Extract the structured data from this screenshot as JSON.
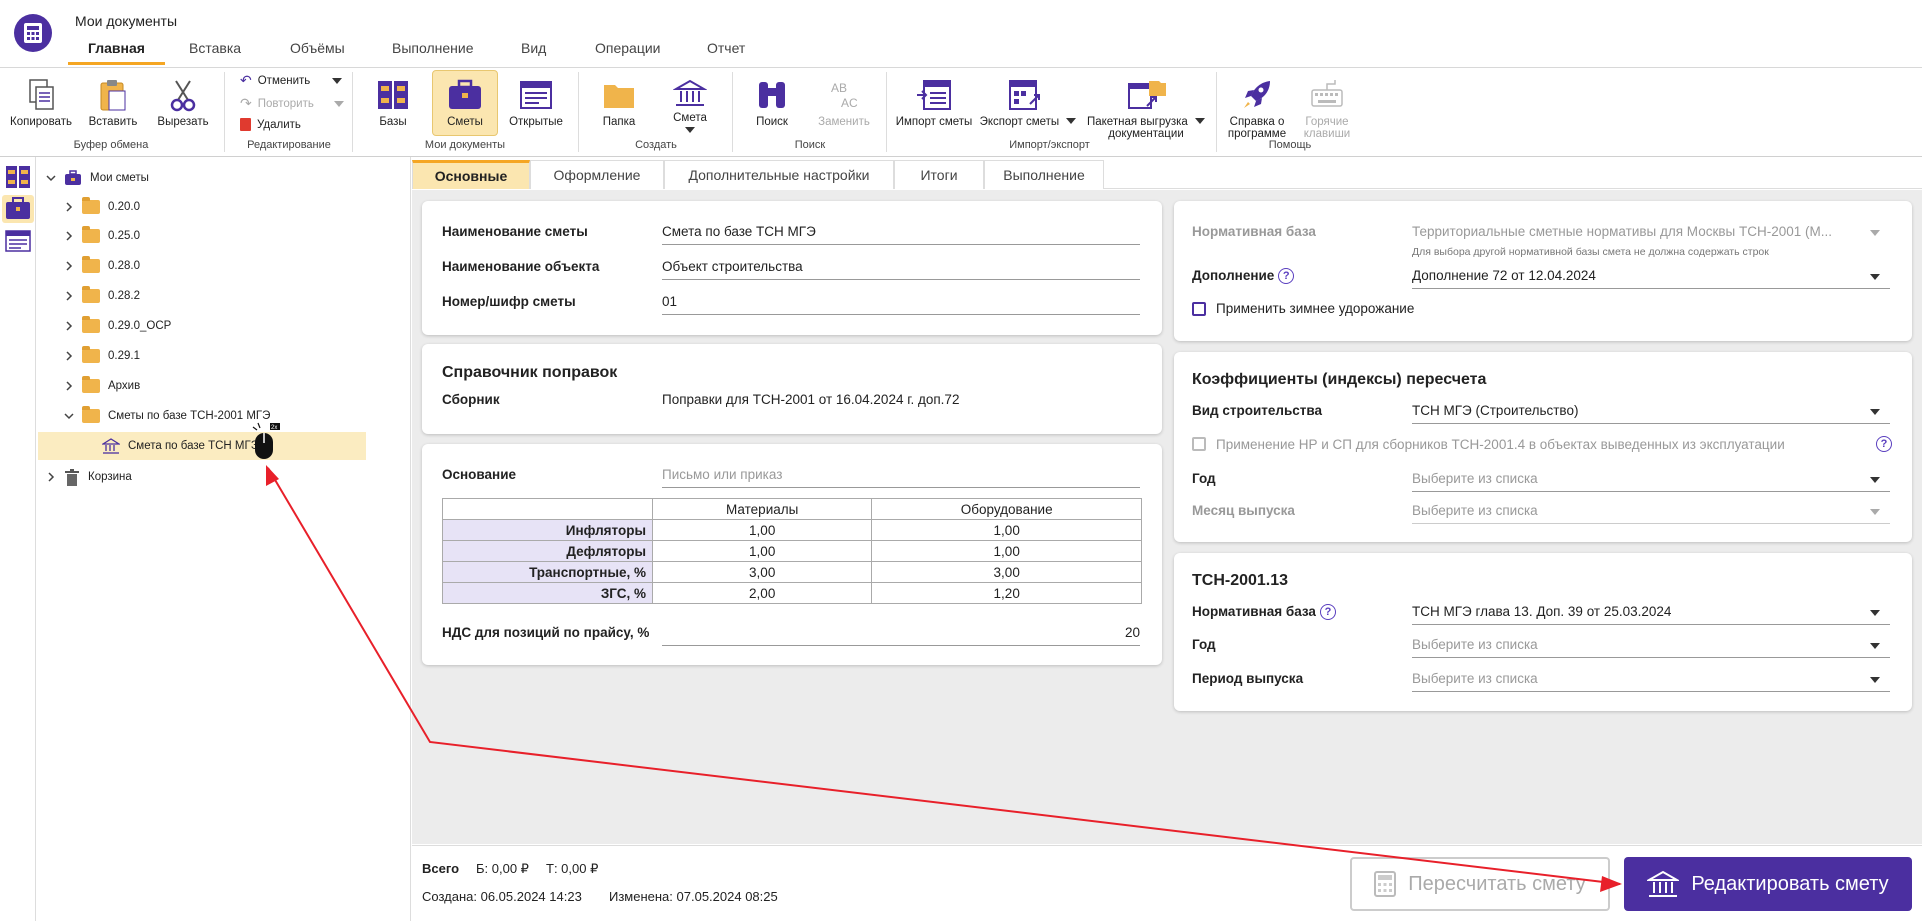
{
  "window": {
    "title": "Мои документы"
  },
  "ribbon_tabs": [
    "Главная",
    "Вставка",
    "Объёмы",
    "Выполнение",
    "Вид",
    "Операции",
    "Отчет"
  ],
  "ribbon": {
    "copy": "Копировать",
    "paste": "Вставить",
    "cut": "Вырезать",
    "group_clipboard": "Буфер обмена",
    "undo": "Отменить",
    "redo": "Повторить",
    "delete": "Удалить",
    "group_edit": "Редактирование",
    "bases": "Базы",
    "estimates": "Сметы",
    "opened": "Открытые",
    "group_mydocs": "Мои документы",
    "folder": "Папка",
    "estimate": "Смета",
    "group_create": "Создать",
    "search": "Поиск",
    "replace": "Заменить",
    "group_search": "Поиск",
    "import": "Импорт сметы",
    "export": "Экспорт сметы",
    "batch_line1": "Пакетная выгрузка",
    "batch_line2": "документации",
    "group_io": "Импорт/экспорт",
    "help_line1": "Справка о",
    "help_line2": "программе",
    "hotkeys_line1": "Горячие",
    "hotkeys_line2": "клавиши",
    "group_help": "Помощь"
  },
  "tree": {
    "root": "Мои сметы",
    "folders": [
      "0.20.0",
      "0.25.0",
      "0.28.0",
      "0.28.2",
      "0.29.0_ОСР",
      "0.29.1",
      "Архив",
      "Сметы по базе ТСН-2001 МГЭ"
    ],
    "selected_item": "Смета по базе ТСН МГЭ",
    "trash": "Корзина"
  },
  "content_tabs": [
    "Основные",
    "Оформление",
    "Дополнительные настройки",
    "Итоги",
    "Выполнение"
  ],
  "main_card": {
    "name_label": "Наименование сметы",
    "name_value": "Смета по базе ТСН МГЭ",
    "object_label": "Наименование объекта",
    "object_value": "Объект строительства",
    "number_label": "Номер/шифр сметы",
    "number_value": "01"
  },
  "corrections_card": {
    "title": "Справочник поправок",
    "collection_label": "Сборник",
    "collection_value": "Поправки для ТСН-2001 от 16.04.2024 г. доп.72"
  },
  "basis_card": {
    "basis_label": "Основание",
    "basis_placeholder": "Письмо или приказ",
    "col_materials": "Материалы",
    "col_equipment": "Оборудование",
    "rows": [
      {
        "label": "Инфляторы",
        "materials": "1,00",
        "equipment": "1,00"
      },
      {
        "label": "Дефляторы",
        "materials": "1,00",
        "equipment": "1,00"
      },
      {
        "label": "Транспортные, %",
        "materials": "3,00",
        "equipment": "3,00"
      },
      {
        "label": "ЗГС, %",
        "materials": "2,00",
        "equipment": "1,20"
      }
    ],
    "vat_label": "НДС для позиций по прайсу, %",
    "vat_value": "20"
  },
  "norm_card": {
    "base_label": "Нормативная база",
    "base_value": "Территориальные сметные нормативы для Москвы ТСН-2001 (М...",
    "base_hint": "Для выбора другой нормативной базы смета не должна содержать строк",
    "addition_label": "Дополнение",
    "addition_value": "Дополнение 72 от 12.04.2024",
    "winter_label": "Применить зимнее удорожание"
  },
  "coef_card": {
    "title": "Коэффициенты (индексы) пересчета",
    "type_label": "Вид строительства",
    "type_value": "ТСН МГЭ (Строительство)",
    "nr_sp_label": "Применение НР и СП для сборников ТСН-2001.4 в объектах выведенных из эксплуатации",
    "year_label": "Год",
    "year_placeholder": "Выберите из списка",
    "month_label": "Месяц выпуска",
    "month_placeholder": "Выберите из списка"
  },
  "tsn_card": {
    "title": "ТСН-2001.13",
    "base_label": "Нормативная база",
    "base_value": "ТСН МГЭ глава 13. Доп. 39 от 25.03.2024",
    "year_label": "Год",
    "year_placeholder": "Выберите из списка",
    "period_label": "Период выпуска",
    "period_placeholder": "Выберите из списка"
  },
  "footer": {
    "total_label": "Всего",
    "b_value": "Б: 0,00 ₽",
    "t_value": "Т: 0,00 ₽",
    "created": "Создана: 06.05.2024 14:23",
    "changed": "Изменена: 07.05.2024 08:25",
    "recalc_button": "Пересчитать смету",
    "edit_button": "Редактировать смету"
  },
  "colors": {
    "accent": "#4b2fa0",
    "tab_highlight": "#f5a623",
    "selection": "#fbecc1",
    "annotation_arrow": "#e8202a"
  }
}
